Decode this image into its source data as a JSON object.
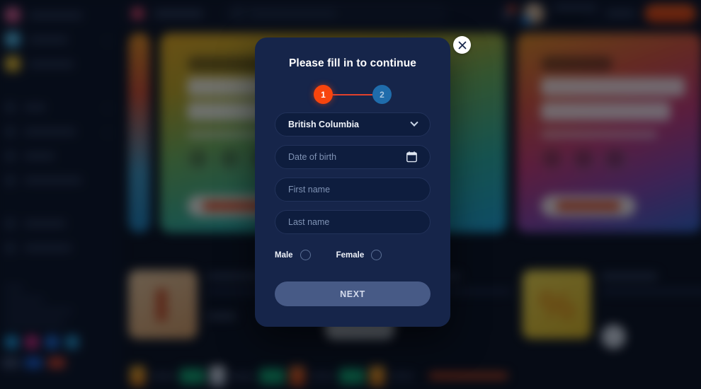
{
  "modal": {
    "title": "Please fill in to continue",
    "close_icon": "close-icon",
    "steps": [
      {
        "label": "1",
        "state": "active"
      },
      {
        "label": "2",
        "state": "inactive"
      }
    ],
    "province_select": {
      "value": "British Columbia",
      "chevron_icon": "chevron-down-icon"
    },
    "fields": [
      {
        "name": "date-of-birth",
        "placeholder": "Date of birth",
        "value": "",
        "icon": "calendar-icon"
      },
      {
        "name": "first-name",
        "placeholder": "First name",
        "value": ""
      },
      {
        "name": "last-name",
        "placeholder": "Last name",
        "value": ""
      }
    ],
    "gender": {
      "male_label": "Male",
      "female_label": "Female"
    },
    "next_label": "NEXT",
    "colors": {
      "panel": "#16254a",
      "field": "#0e1d3e",
      "step_active": "#f8450d",
      "step_inactive": "#1f6cab",
      "step_line": "#e2412c",
      "next_button": "#475a86"
    }
  }
}
